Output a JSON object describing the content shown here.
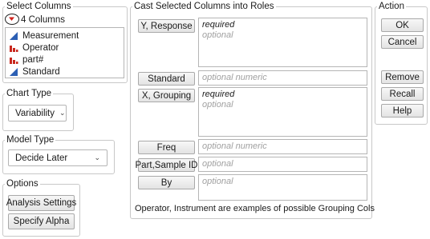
{
  "select_columns": {
    "title": "Select Columns",
    "count_label": "4 Columns",
    "columns": [
      {
        "name": "Measurement",
        "icon": "continuous-icon"
      },
      {
        "name": "Operator",
        "icon": "nominal-icon"
      },
      {
        "name": "part#",
        "icon": "nominal-icon"
      },
      {
        "name": "Standard",
        "icon": "continuous-icon"
      }
    ]
  },
  "chart_type": {
    "title": "Chart Type",
    "value": "Variability"
  },
  "model_type": {
    "title": "Model Type",
    "value": "Decide Later"
  },
  "options": {
    "title": "Options",
    "analysis_settings": "Analysis Settings",
    "specify_alpha": "Specify Alpha"
  },
  "cast": {
    "title": "Cast Selected Columns into Roles",
    "roles": [
      {
        "label": "Y, Response",
        "line1": "required",
        "line2": "optional"
      },
      {
        "label": "Standard",
        "line1": "optional numeric"
      },
      {
        "label": "X, Grouping",
        "line1": "required",
        "line2": "optional"
      },
      {
        "label": "Freq",
        "line1": "optional numeric"
      },
      {
        "label": "Part,Sample ID",
        "line1": "optional"
      },
      {
        "label": "By",
        "line1": "optional"
      }
    ],
    "footer": "Operator, Instrument are examples of possible Grouping Cols"
  },
  "action": {
    "title": "Action",
    "ok": "OK",
    "cancel": "Cancel",
    "remove": "Remove",
    "recall": "Recall",
    "help": "Help"
  },
  "colors": {
    "continuous": "#2b5fb4",
    "nominal": "#c8281e",
    "disclosure_red": "#d0201a"
  }
}
